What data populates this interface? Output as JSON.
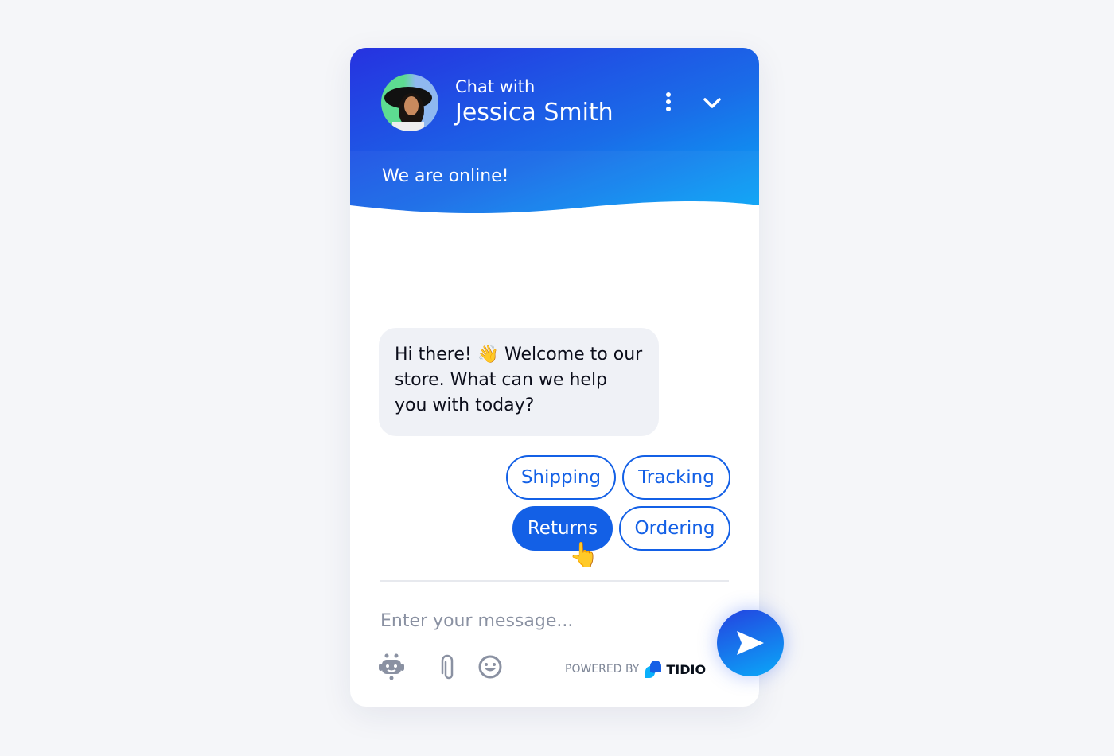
{
  "header": {
    "subtitle": "Chat with",
    "agent_name": "Jessica Smith",
    "status": "We are online!"
  },
  "messages": [
    {
      "from": "agent",
      "text": "Hi there! 👋 Welcome to our store. What can we help you with today?"
    }
  ],
  "quick_replies": [
    {
      "label": "Shipping",
      "active": false
    },
    {
      "label": "Tracking",
      "active": false
    },
    {
      "label": "Returns",
      "active": true
    },
    {
      "label": "Ordering",
      "active": false
    }
  ],
  "composer": {
    "placeholder": "Enter your message...",
    "value": ""
  },
  "footer": {
    "powered_by": "POWERED BY",
    "brand": "TIDIO"
  },
  "colors": {
    "accent": "#1360e6",
    "gradient_start": "#2632e0",
    "gradient_end": "#03bdfc",
    "icon_gray": "#8a91a2"
  },
  "icons": [
    "more-vertical-icon",
    "chevron-down-icon",
    "bot-icon",
    "paperclip-icon",
    "emoji-icon",
    "send-icon",
    "tidio-logo"
  ]
}
